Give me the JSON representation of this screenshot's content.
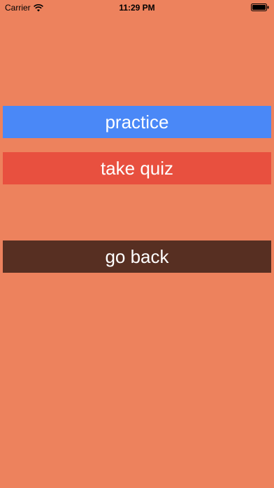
{
  "status_bar": {
    "carrier": "Carrier",
    "time": "11:29 PM",
    "icons": [
      "wifi-icon",
      "battery-icon"
    ]
  },
  "menu": {
    "practice_label": "practice",
    "quiz_label": "take quiz",
    "back_label": "go back"
  },
  "colors": {
    "background": "#ed825d",
    "practice": "#4a88f7",
    "quiz": "#e8503f",
    "back": "#572f22",
    "button_text": "#ffffff"
  }
}
